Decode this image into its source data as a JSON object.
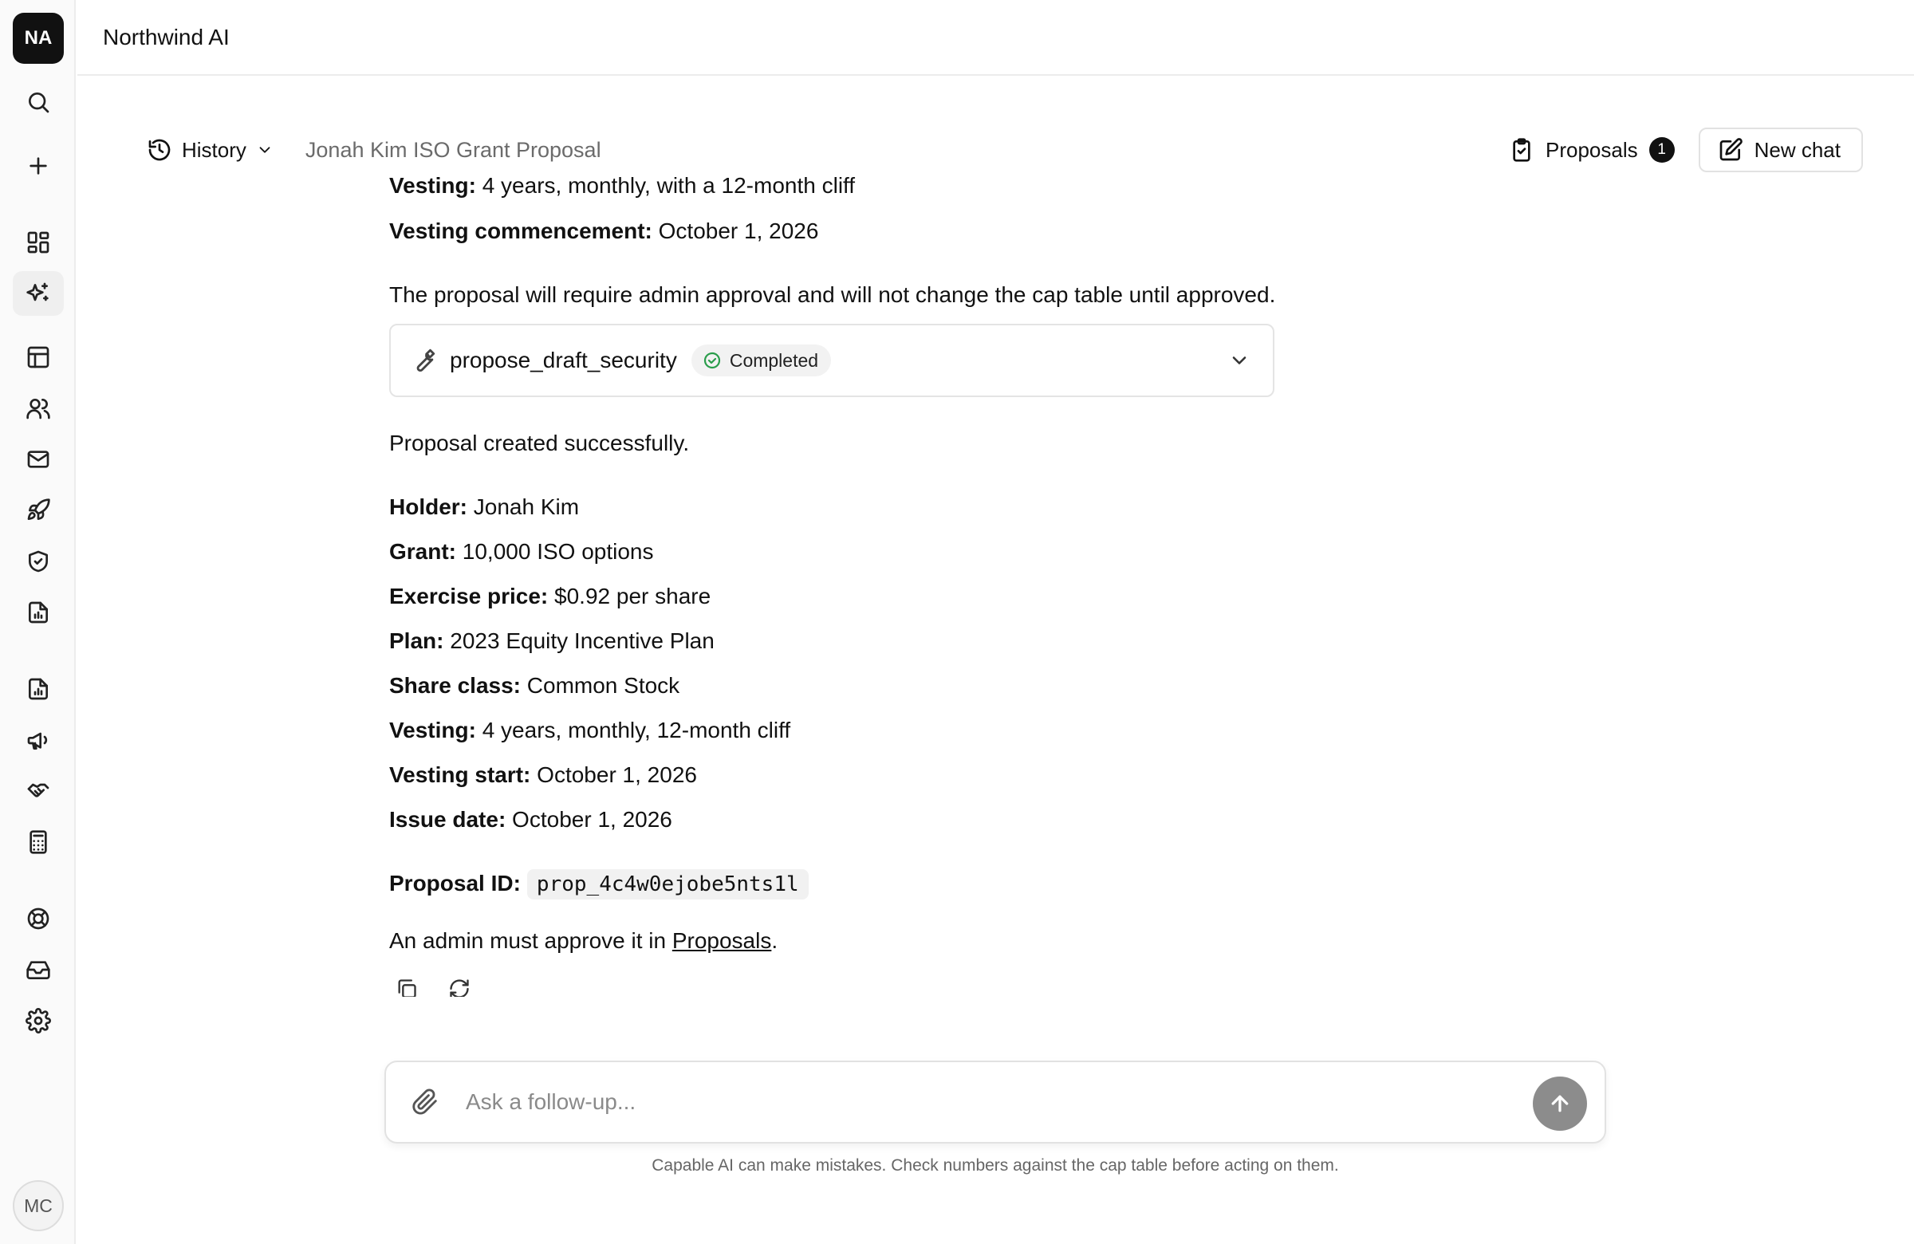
{
  "app": {
    "title": "Northwind AI",
    "org_initials": "NA",
    "user_initials": "MC"
  },
  "header": {
    "history_label": "History",
    "conversation_title": "Jonah Kim ISO Grant Proposal",
    "proposals_label": "Proposals",
    "proposals_count": "1",
    "new_chat_label": "New chat"
  },
  "rail": {
    "icons": [
      "search-icon",
      "plus-icon",
      "dashboard-icon",
      "sparkles-icon",
      "table-icon",
      "users-icon",
      "mail-icon",
      "rocket-icon",
      "shield-icon",
      "report-icon",
      "report-chart-icon",
      "megaphone-icon",
      "handshake-icon",
      "calculator-icon",
      "lifebuoy-icon",
      "inbox-icon",
      "settings-icon"
    ],
    "active": "sparkles-icon"
  },
  "message": {
    "top_vesting_label": "Vesting:",
    "top_vesting_value": " 4 years, monthly, with a 12-month cliff",
    "top_commencement_label": "Vesting commencement:",
    "top_commencement_value": " October 1, 2026",
    "approval_note": "The proposal will require admin approval and will not change the cap table until approved.",
    "tool_name": "propose_draft_security",
    "tool_status": "Completed",
    "success_text": "Proposal created successfully.",
    "fields": [
      {
        "label": "Holder:",
        "value": " Jonah Kim"
      },
      {
        "label": "Grant:",
        "value": " 10,000 ISO options"
      },
      {
        "label": "Exercise price:",
        "value": " $0.92 per share"
      },
      {
        "label": "Plan:",
        "value": " 2023 Equity Incentive Plan"
      },
      {
        "label": "Share class:",
        "value": " Common Stock"
      },
      {
        "label": "Vesting:",
        "value": " 4 years, monthly, 12-month cliff"
      },
      {
        "label": "Vesting start:",
        "value": " October 1, 2026"
      },
      {
        "label": "Issue date:",
        "value": " October 1, 2026"
      }
    ],
    "proposal_id_label": "Proposal ID:",
    "proposal_id": "prop_4c4w0ejobe5nts1l",
    "admin_note_prefix": "An admin must approve it in ",
    "admin_note_link": "Proposals",
    "admin_note_suffix": "."
  },
  "composer": {
    "placeholder": "Ask a follow-up...",
    "disclaimer": "Capable AI can make mistakes. Check numbers against the cap table before acting on them."
  },
  "colors": {
    "accent": "#111111",
    "success": "#2a9d4b",
    "send_disabled": "#8c8c8c"
  }
}
